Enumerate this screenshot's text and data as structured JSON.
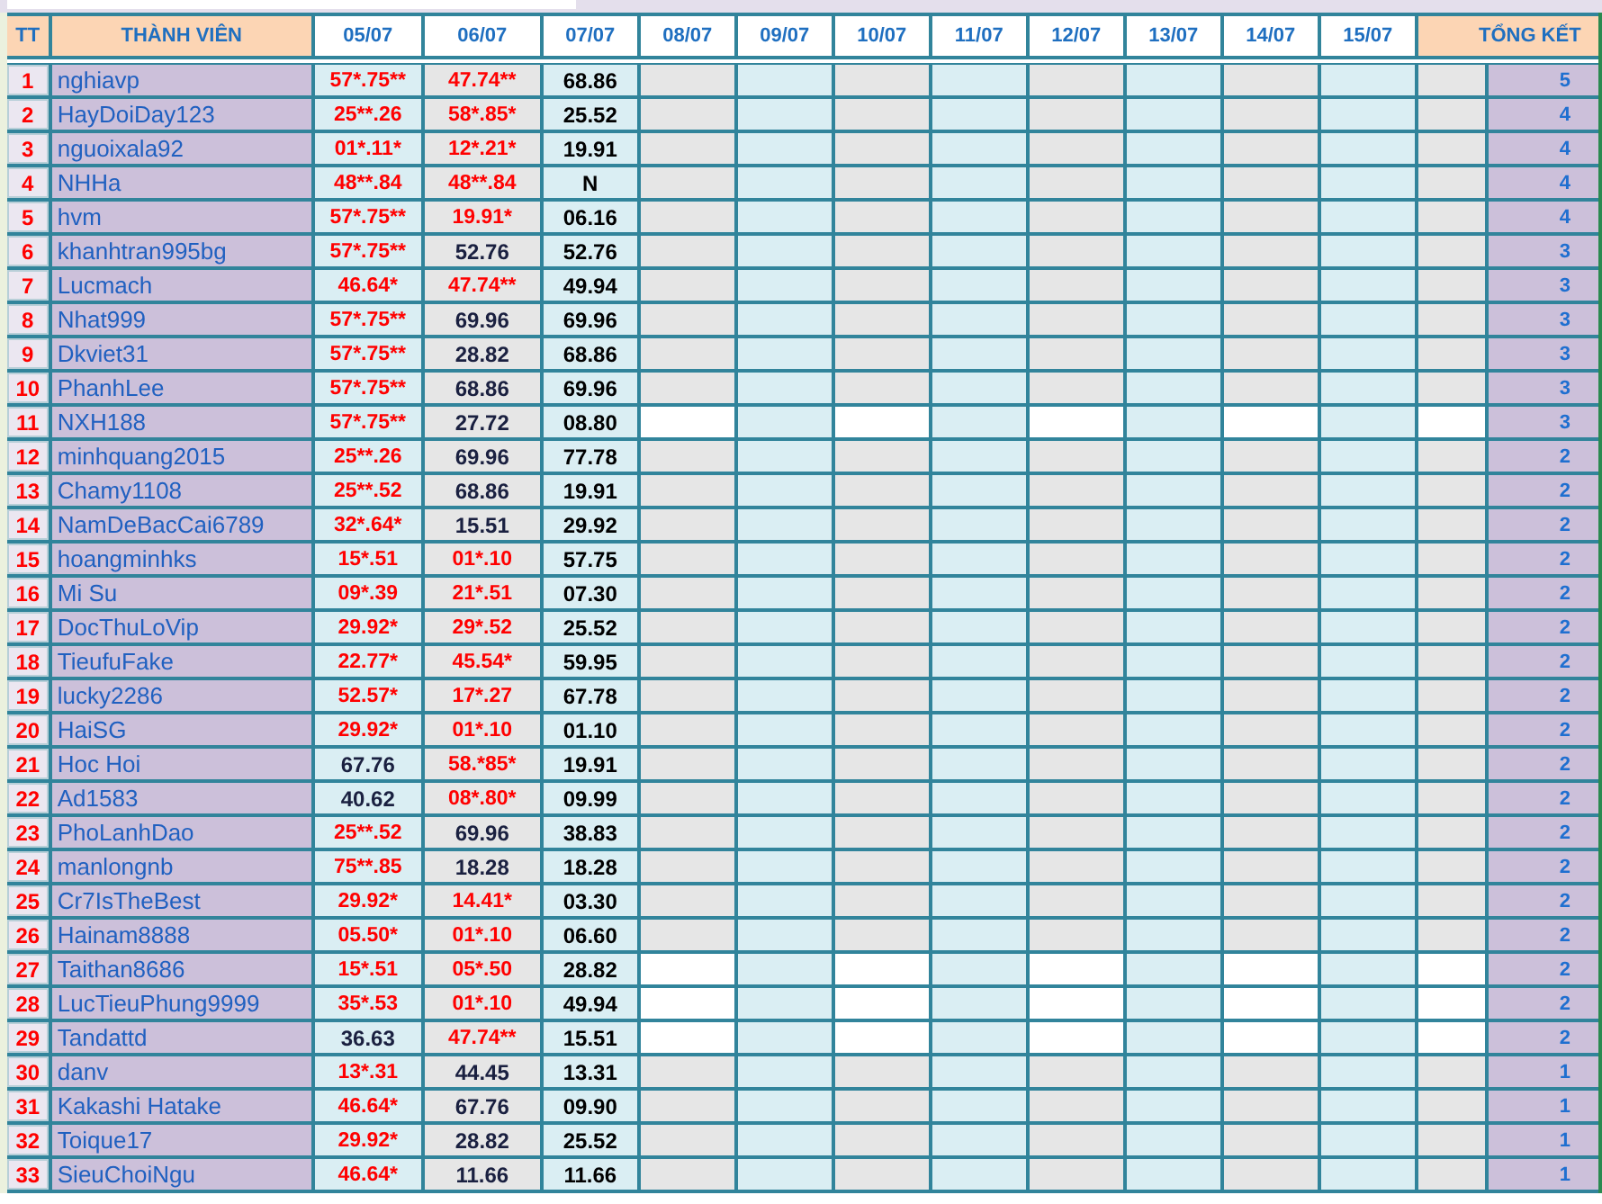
{
  "columns": [
    "TT",
    "THÀNH VIÊN",
    "05/07",
    "06/07",
    "07/07",
    "08/07",
    "09/07",
    "10/07",
    "11/07",
    "12/07",
    "13/07",
    "14/07",
    "15/07",
    "TỔNG KẾT"
  ],
  "rows": [
    {
      "tt": "1",
      "name": "nghiavp",
      "scores": [
        {
          "text": "57*.75**",
          "hit": true
        },
        {
          "text": "47.74**",
          "hit": true
        },
        {
          "text": "68.86",
          "hit": false
        }
      ],
      "total": "5",
      "shaded": true
    },
    {
      "tt": "2",
      "name": "HayDoiDay123",
      "scores": [
        {
          "text": "25**.26",
          "hit": true
        },
        {
          "text": "58*.85*",
          "hit": true
        },
        {
          "text": "25.52",
          "hit": false
        }
      ],
      "total": "4",
      "shaded": true
    },
    {
      "tt": "3",
      "name": "nguoixala92",
      "scores": [
        {
          "text": "01*.11*",
          "hit": true
        },
        {
          "text": "12*.21*",
          "hit": true
        },
        {
          "text": "19.91",
          "hit": false
        }
      ],
      "total": "4",
      "shaded": true
    },
    {
      "tt": "4",
      "name": "NHHa",
      "scores": [
        {
          "text": "48**.84",
          "hit": true
        },
        {
          "text": "48**.84",
          "hit": true
        },
        {
          "text": "N",
          "hit": false
        }
      ],
      "total": "4",
      "shaded": true
    },
    {
      "tt": "5",
      "name": "hvm",
      "scores": [
        {
          "text": "57*.75**",
          "hit": true
        },
        {
          "text": "19.91*",
          "hit": true
        },
        {
          "text": "06.16",
          "hit": false
        }
      ],
      "total": "4",
      "shaded": true
    },
    {
      "tt": "6",
      "name": "khanhtran995bg",
      "scores": [
        {
          "text": "57*.75**",
          "hit": true
        },
        {
          "text": "52.76",
          "hit": false
        },
        {
          "text": "52.76",
          "hit": false
        }
      ],
      "total": "3",
      "shaded": true
    },
    {
      "tt": "7",
      "name": "Lucmach",
      "scores": [
        {
          "text": "46.64*",
          "hit": true
        },
        {
          "text": "47.74**",
          "hit": true
        },
        {
          "text": "49.94",
          "hit": false
        }
      ],
      "total": "3",
      "shaded": true
    },
    {
      "tt": "8",
      "name": "Nhat999",
      "scores": [
        {
          "text": "57*.75**",
          "hit": true
        },
        {
          "text": "69.96",
          "hit": false
        },
        {
          "text": "69.96",
          "hit": false
        }
      ],
      "total": "3",
      "shaded": true
    },
    {
      "tt": "9",
      "name": "Dkviet31",
      "scores": [
        {
          "text": "57*.75**",
          "hit": true
        },
        {
          "text": "28.82",
          "hit": false
        },
        {
          "text": "68.86",
          "hit": false
        }
      ],
      "total": "3",
      "shaded": true
    },
    {
      "tt": "10",
      "name": "PhanhLee",
      "scores": [
        {
          "text": "57*.75**",
          "hit": true
        },
        {
          "text": "68.86",
          "hit": false
        },
        {
          "text": "69.96",
          "hit": false
        }
      ],
      "total": "3",
      "shaded": true
    },
    {
      "tt": "11",
      "name": "NXH188",
      "scores": [
        {
          "text": "57*.75**",
          "hit": true
        },
        {
          "text": "27.72",
          "hit": false
        },
        {
          "text": "08.80",
          "hit": false
        }
      ],
      "total": "3",
      "shaded": false
    },
    {
      "tt": "12",
      "name": "minhquang2015",
      "scores": [
        {
          "text": "25**.26",
          "hit": true
        },
        {
          "text": "69.96",
          "hit": false
        },
        {
          "text": "77.78",
          "hit": false
        }
      ],
      "total": "2",
      "shaded": true
    },
    {
      "tt": "13",
      "name": "Chamy1108",
      "scores": [
        {
          "text": "25**.52",
          "hit": true
        },
        {
          "text": "68.86",
          "hit": false
        },
        {
          "text": "19.91",
          "hit": false
        }
      ],
      "total": "2",
      "shaded": true
    },
    {
      "tt": "14",
      "name": "NamDeBacCai6789",
      "scores": [
        {
          "text": "32*.64*",
          "hit": true
        },
        {
          "text": "15.51",
          "hit": false
        },
        {
          "text": "29.92",
          "hit": false
        }
      ],
      "total": "2",
      "shaded": true
    },
    {
      "tt": "15",
      "name": "hoangminhks",
      "scores": [
        {
          "text": "15*.51",
          "hit": true
        },
        {
          "text": "01*.10",
          "hit": true
        },
        {
          "text": "57.75",
          "hit": false
        }
      ],
      "total": "2",
      "shaded": true
    },
    {
      "tt": "16",
      "name": "Mi Su",
      "scores": [
        {
          "text": "09*.39",
          "hit": true
        },
        {
          "text": "21*.51",
          "hit": true
        },
        {
          "text": "07.30",
          "hit": false
        }
      ],
      "total": "2",
      "shaded": true
    },
    {
      "tt": "17",
      "name": "DocThuLoVip",
      "scores": [
        {
          "text": "29.92*",
          "hit": true
        },
        {
          "text": "29*.52",
          "hit": true
        },
        {
          "text": "25.52",
          "hit": false
        }
      ],
      "total": "2",
      "shaded": true
    },
    {
      "tt": "18",
      "name": "TieufuFake",
      "scores": [
        {
          "text": "22.77*",
          "hit": true
        },
        {
          "text": "45.54*",
          "hit": true
        },
        {
          "text": "59.95",
          "hit": false
        }
      ],
      "total": "2",
      "shaded": true
    },
    {
      "tt": "19",
      "name": "lucky2286",
      "scores": [
        {
          "text": "52.57*",
          "hit": true
        },
        {
          "text": "17*.27",
          "hit": true
        },
        {
          "text": "67.78",
          "hit": false
        }
      ],
      "total": "2",
      "shaded": true
    },
    {
      "tt": "20",
      "name": "HaiSG",
      "scores": [
        {
          "text": "29.92*",
          "hit": true
        },
        {
          "text": "01*.10",
          "hit": true
        },
        {
          "text": "01.10",
          "hit": false
        }
      ],
      "total": "2",
      "shaded": true
    },
    {
      "tt": "21",
      "name": "Hoc Hoi",
      "scores": [
        {
          "text": "67.76",
          "hit": false
        },
        {
          "text": "58.*85*",
          "hit": true
        },
        {
          "text": "19.91",
          "hit": false
        }
      ],
      "total": "2",
      "shaded": true
    },
    {
      "tt": "22",
      "name": "Ad1583",
      "scores": [
        {
          "text": "40.62",
          "hit": false
        },
        {
          "text": "08*.80*",
          "hit": true
        },
        {
          "text": "09.99",
          "hit": false
        }
      ],
      "total": "2",
      "shaded": true
    },
    {
      "tt": "23",
      "name": "PhoLanhDao",
      "scores": [
        {
          "text": "25**.52",
          "hit": true
        },
        {
          "text": "69.96",
          "hit": false
        },
        {
          "text": "38.83",
          "hit": false
        }
      ],
      "total": "2",
      "shaded": true
    },
    {
      "tt": "24",
      "name": "manlongnb",
      "scores": [
        {
          "text": "75**.85",
          "hit": true
        },
        {
          "text": "18.28",
          "hit": false
        },
        {
          "text": "18.28",
          "hit": false
        }
      ],
      "total": "2",
      "shaded": true
    },
    {
      "tt": "25",
      "name": "Cr7IsTheBest",
      "scores": [
        {
          "text": "29.92*",
          "hit": true
        },
        {
          "text": "14.41*",
          "hit": true
        },
        {
          "text": "03.30",
          "hit": false
        }
      ],
      "total": "2",
      "shaded": true
    },
    {
      "tt": "26",
      "name": "Hainam8888",
      "scores": [
        {
          "text": "05.50*",
          "hit": true
        },
        {
          "text": "01*.10",
          "hit": true
        },
        {
          "text": "06.60",
          "hit": false
        }
      ],
      "total": "2",
      "shaded": true
    },
    {
      "tt": "27",
      "name": "Taithan8686",
      "scores": [
        {
          "text": "15*.51",
          "hit": true
        },
        {
          "text": "05*.50",
          "hit": true
        },
        {
          "text": "28.82",
          "hit": false
        }
      ],
      "total": "2",
      "shaded": false
    },
    {
      "tt": "28",
      "name": "LucTieuPhung9999",
      "scores": [
        {
          "text": "35*.53",
          "hit": true
        },
        {
          "text": "01*.10",
          "hit": true
        },
        {
          "text": "49.94",
          "hit": false
        }
      ],
      "total": "2",
      "shaded": false
    },
    {
      "tt": "29",
      "name": "Tandattd",
      "scores": [
        {
          "text": "36.63",
          "hit": false
        },
        {
          "text": "47.74**",
          "hit": true
        },
        {
          "text": "15.51",
          "hit": false
        }
      ],
      "total": "2",
      "shaded": false
    },
    {
      "tt": "30",
      "name": "danv",
      "scores": [
        {
          "text": "13*.31",
          "hit": true
        },
        {
          "text": "44.45",
          "hit": false
        },
        {
          "text": "13.31",
          "hit": false
        }
      ],
      "total": "1",
      "shaded": true
    },
    {
      "tt": "31",
      "name": "Kakashi Hatake",
      "scores": [
        {
          "text": "46.64*",
          "hit": true
        },
        {
          "text": "67.76",
          "hit": false
        },
        {
          "text": "09.90",
          "hit": false
        }
      ],
      "total": "1",
      "shaded": true
    },
    {
      "tt": "32",
      "name": "Toique17",
      "scores": [
        {
          "text": "29.92*",
          "hit": true
        },
        {
          "text": "28.82",
          "hit": false
        },
        {
          "text": "25.52",
          "hit": false
        }
      ],
      "total": "1",
      "shaded": true
    },
    {
      "tt": "33",
      "name": "SieuChoiNgu",
      "scores": [
        {
          "text": "46.64*",
          "hit": true
        },
        {
          "text": "11.66",
          "hit": false
        },
        {
          "text": "11.66",
          "hit": false
        }
      ],
      "total": "1",
      "shaded": true
    }
  ]
}
